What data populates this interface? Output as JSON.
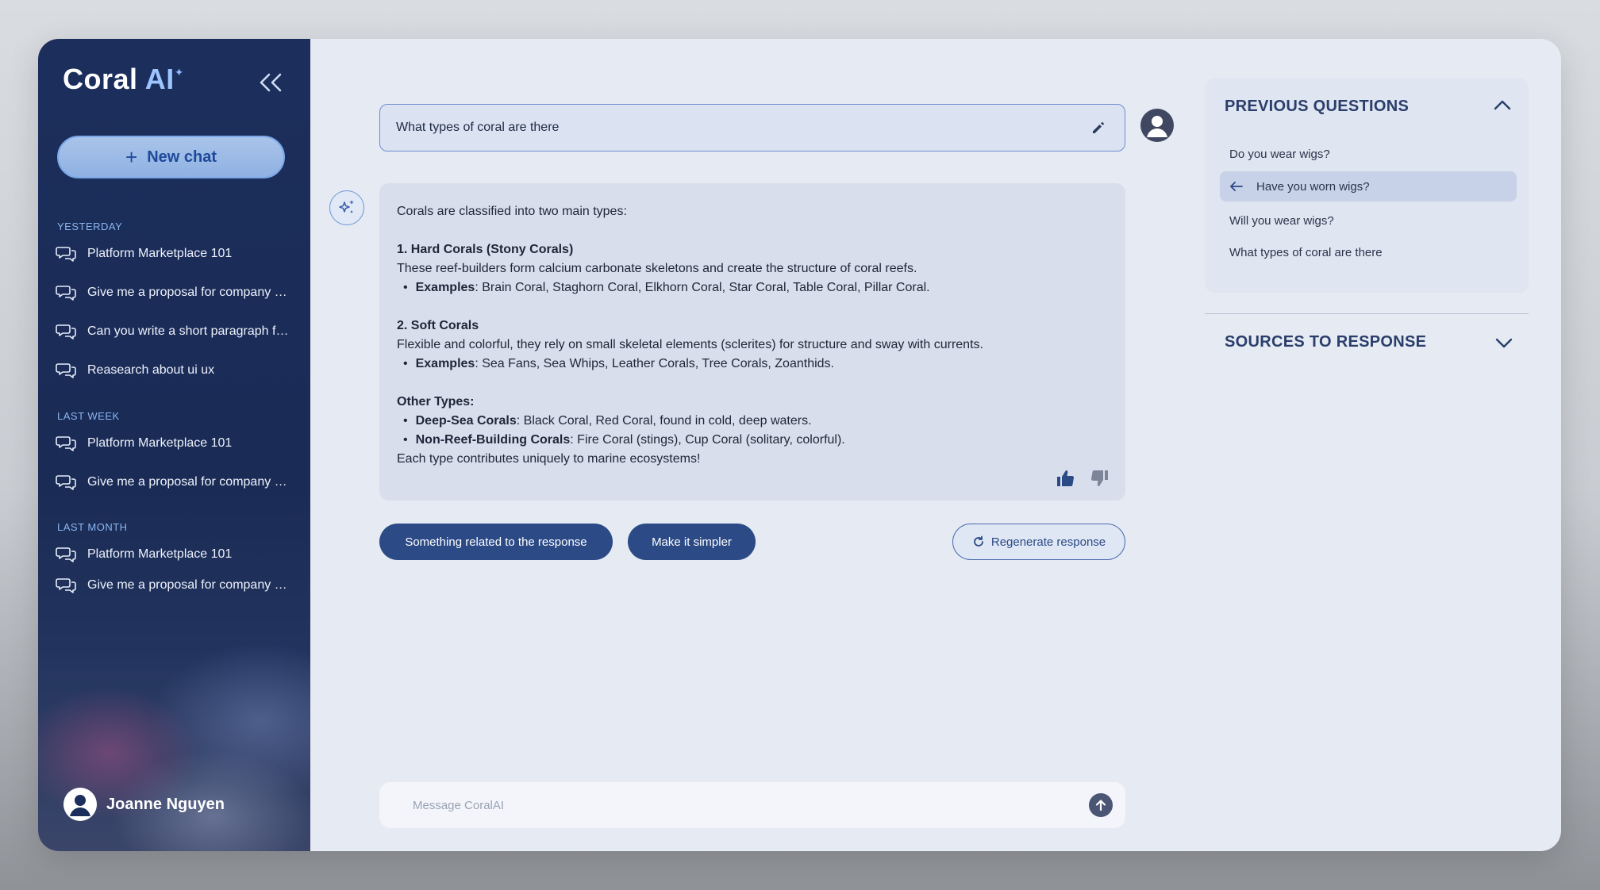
{
  "brand": {
    "name": "Coral",
    "ai": "AI",
    "spark": "✦"
  },
  "sidebar": {
    "new_chat_label": "New chat",
    "sections": [
      {
        "label": "YESTERDAY",
        "items": [
          "Platform Marketplace 101",
          "Give me a proposal for company about",
          "Can you write a short paragraph for the",
          "Reasearch about ui ux"
        ]
      },
      {
        "label": "LAST WEEK",
        "items": [
          "Platform Marketplace 101",
          "Give me a proposal for company about"
        ]
      },
      {
        "label": "LAST MONTH",
        "items": [
          "Platform Marketplace 101",
          "Give me a proposal for company about"
        ]
      }
    ],
    "user_name": "Joanne Nguyen"
  },
  "main": {
    "question": "What types of coral are there",
    "answer": {
      "intro": "Corals are classified into two main types:",
      "hard_title": "1. Hard Corals (Stony Corals)",
      "hard_desc": "These reef-builders form calcium carbonate skeletons and create the structure of coral reefs.",
      "hard_ex_label": "Examples",
      "hard_ex": ": Brain Coral, Staghorn Coral, Elkhorn Coral, Star Coral, Table Coral, Pillar Coral.",
      "soft_title": "2. Soft Corals",
      "soft_desc": "Flexible and colorful, they rely on small skeletal elements (sclerites) for structure and sway with currents.",
      "soft_ex_label": "Examples",
      "soft_ex": ": Sea Fans, Sea Whips, Leather Corals, Tree Corals, Zoanthids.",
      "other_title": "Other Types:",
      "deep_label": "Deep-Sea Corals",
      "deep_text": ": Black Coral, Red Coral, found in cold, deep waters.",
      "nonreef_label": "Non-Reef-Building Corals",
      "nonreef_text": ": Fire Coral (stings), Cup Coral (solitary, colorful).",
      "closing": "Each type contributes uniquely to marine ecosystems!"
    },
    "suggestions": [
      "Something related to the response",
      "Make it simpler"
    ],
    "regenerate_label": "Regenerate response",
    "composer_placeholder": "Message CoralAI"
  },
  "right_panel": {
    "previous_title": "PREVIOUS QUESTIONS",
    "previous_items": [
      "Do you wear wigs?",
      "Have you worn wigs?",
      "Will you wear wigs?",
      "What types of coral are there"
    ],
    "sources_title": "SOURCES TO RESPONSE"
  }
}
